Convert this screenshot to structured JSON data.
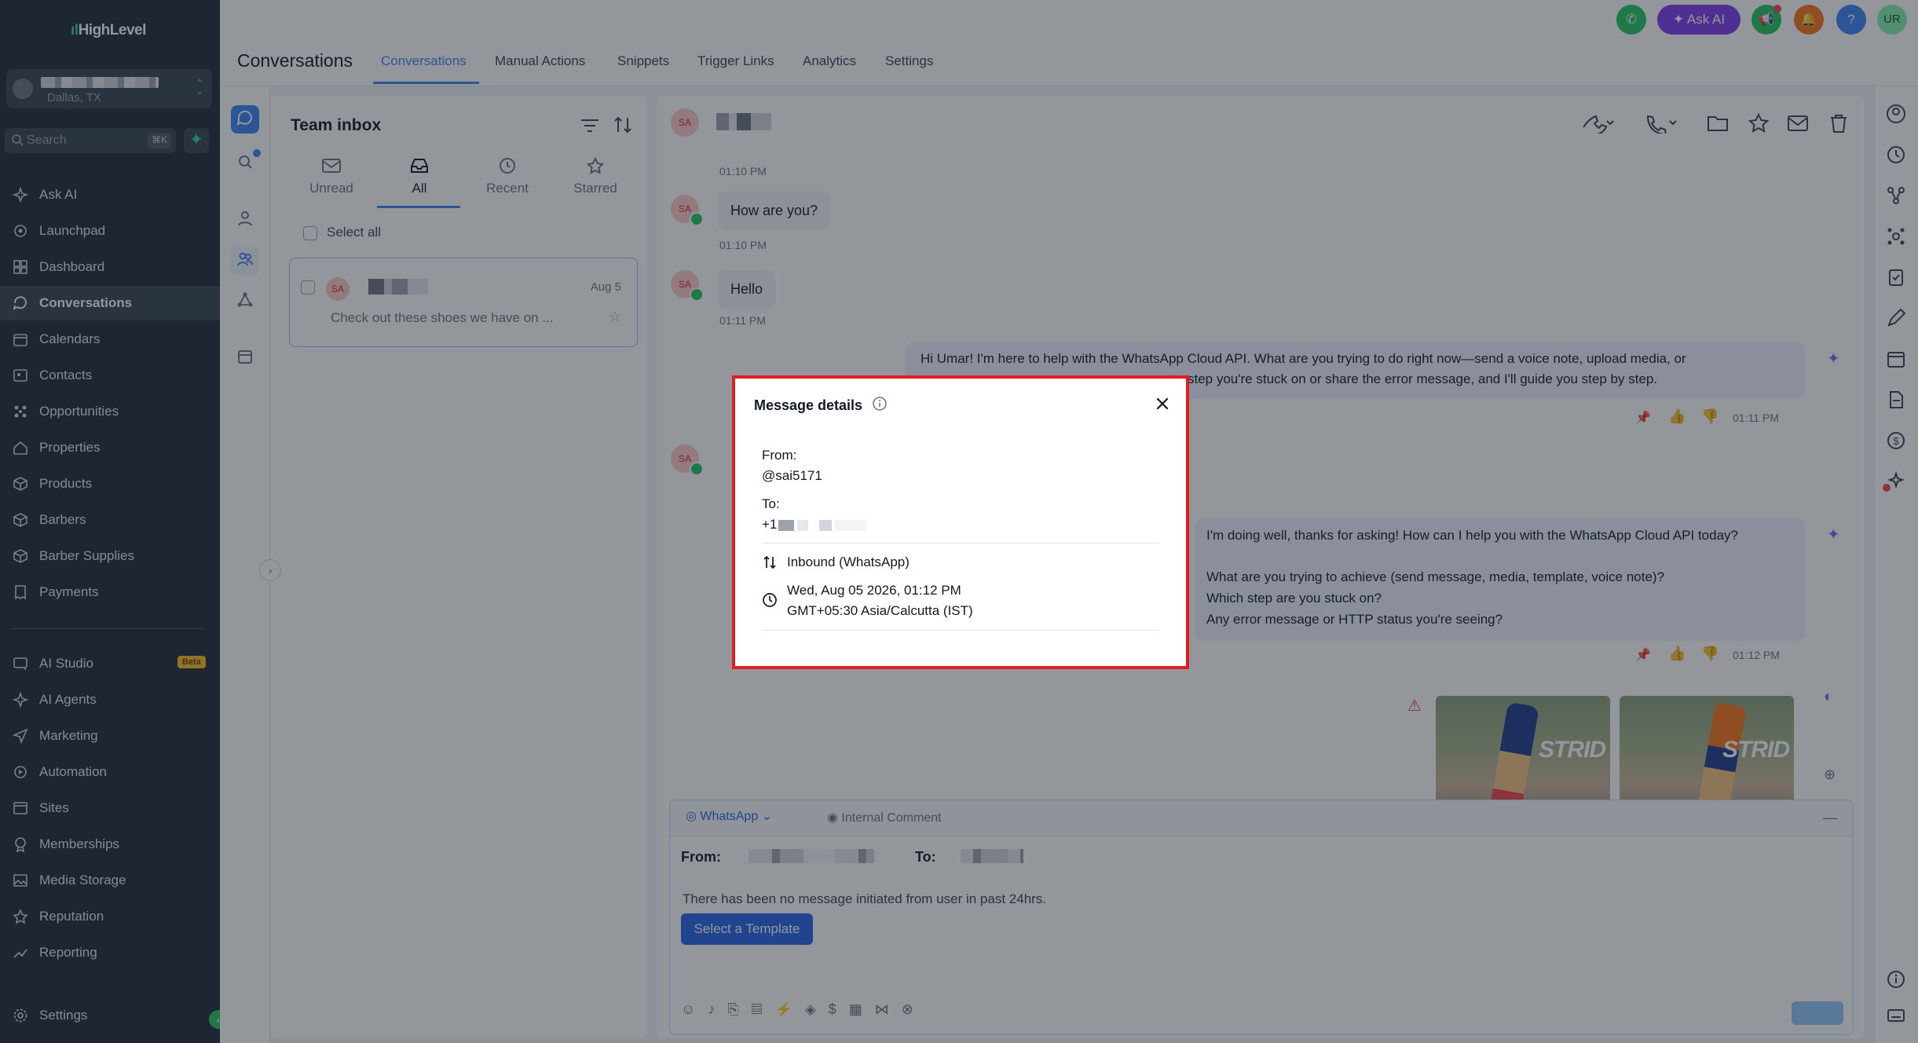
{
  "app": {
    "brand": "HighLevel",
    "location": "Dallas, TX"
  },
  "search": {
    "placeholder": "Search",
    "shortcut": "⌘K"
  },
  "sidebar": {
    "items": [
      {
        "label": "Ask AI",
        "icon": "sparkle-icon"
      },
      {
        "label": "Launchpad",
        "icon": "rocket-icon"
      },
      {
        "label": "Dashboard",
        "icon": "grid-icon"
      },
      {
        "label": "Conversations",
        "icon": "chat-icon",
        "active": true
      },
      {
        "label": "Calendars",
        "icon": "calendar-icon"
      },
      {
        "label": "Contacts",
        "icon": "contact-card-icon"
      },
      {
        "label": "Opportunities",
        "icon": "nodes-icon"
      },
      {
        "label": "Properties",
        "icon": "house-icon"
      },
      {
        "label": "Products",
        "icon": "box-icon"
      },
      {
        "label": "Barbers",
        "icon": "box-icon"
      },
      {
        "label": "Barber Supplies",
        "icon": "box-icon"
      },
      {
        "label": "Payments",
        "icon": "receipt-icon"
      }
    ],
    "items2": [
      {
        "label": "AI Studio",
        "icon": "ai-studio-icon",
        "badge": "Beta"
      },
      {
        "label": "AI Agents",
        "icon": "sparkle-icon"
      },
      {
        "label": "Marketing",
        "icon": "send-icon"
      },
      {
        "label": "Automation",
        "icon": "automation-icon"
      },
      {
        "label": "Sites",
        "icon": "sites-icon"
      },
      {
        "label": "Memberships",
        "icon": "badge-icon"
      },
      {
        "label": "Media Storage",
        "icon": "image-icon"
      },
      {
        "label": "Reputation",
        "icon": "star-icon"
      },
      {
        "label": "Reporting",
        "icon": "trend-icon"
      }
    ],
    "settings": "Settings"
  },
  "header": {
    "title": "Conversations",
    "tabs": [
      "Conversations",
      "Manual Actions",
      "Snippets",
      "Trigger Links",
      "Analytics",
      "Settings"
    ],
    "ask_ai": "Ask AI",
    "user_initials": "UR",
    "help": "?"
  },
  "inbox": {
    "title": "Team inbox",
    "tabs": [
      "Unread",
      "All",
      "Recent",
      "Starred"
    ],
    "select_all": "Select all",
    "conversation": {
      "initials": "SA",
      "date": "Aug 5",
      "preview": "Check out these shoes we have on ..."
    }
  },
  "chat": {
    "initials": "SA",
    "times": [
      "01:10 PM",
      "01:10 PM",
      "01:11 PM",
      "01:11 PM",
      "01:12 PM"
    ],
    "messages_in": [
      "How are you?",
      "Hello"
    ],
    "out1": "Hi Umar! I'm here to help with the WhatsApp Cloud API. What are you trying to do right now—send a voice note, upload media, or",
    "out1b": "step you're stuck on or share the error message, and I'll guide you step by step.",
    "out2_lines": [
      "I'm doing well, thanks for asking! How can I help you with the WhatsApp Cloud API today?",
      "",
      "What are you trying to achieve (send message, media, template, voice note)?",
      "Which step are you stuck on?",
      "Any error message or HTTP status you're seeing?"
    ],
    "photo_text": "STRID"
  },
  "composer": {
    "channel": "WhatsApp",
    "internal": "Internal Comment",
    "from_label": "From:",
    "to_label": "To:",
    "notice": "There has been no message initiated from user in past 24hrs.",
    "template_button": "Select a Template"
  },
  "modal": {
    "title": "Message details",
    "from_label": "From:",
    "from_value": "@sai5171",
    "to_label": "To:",
    "to_prefix": "+1",
    "direction": "Inbound (WhatsApp)",
    "datetime": "Wed, Aug 05 2026, 01:12 PM",
    "timezone": "GMT+05:30 Asia/Calcutta (IST)"
  }
}
